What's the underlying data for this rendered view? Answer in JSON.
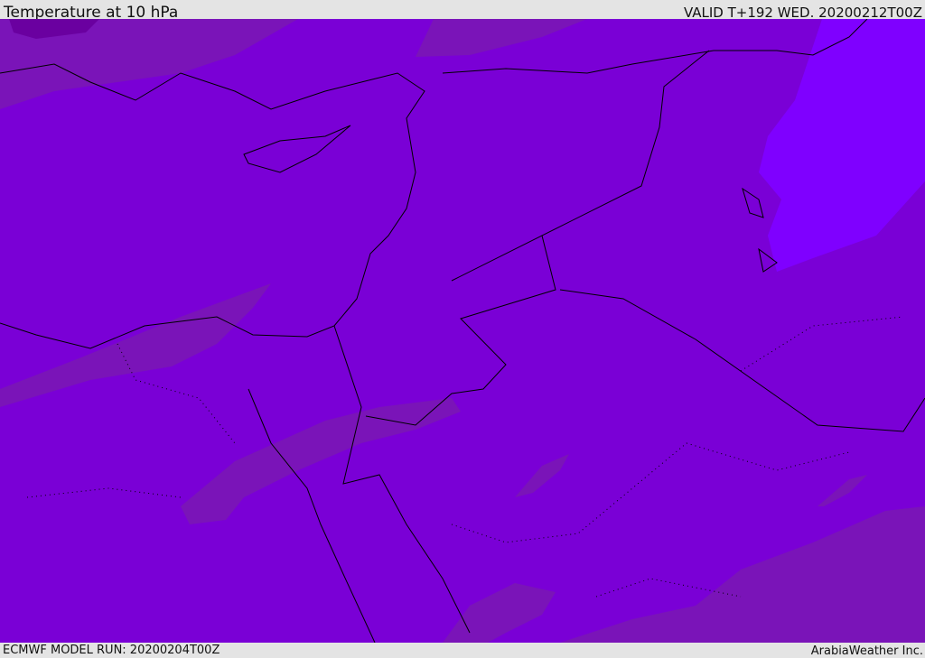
{
  "header": {
    "title": "Temperature at 10 hPa",
    "valid": "VALID T+192 WED. 20200212T00Z"
  },
  "footer": {
    "model_run": "ECMWF MODEL RUN: 20200204T00Z",
    "credit": "ArabiaWeather Inc."
  },
  "colors": {
    "base": "#7a00d6",
    "warm_band": "#7a14b8",
    "darkest": "#6a00a0",
    "cold_region": "#7f00ff",
    "coast": "#000000"
  }
}
